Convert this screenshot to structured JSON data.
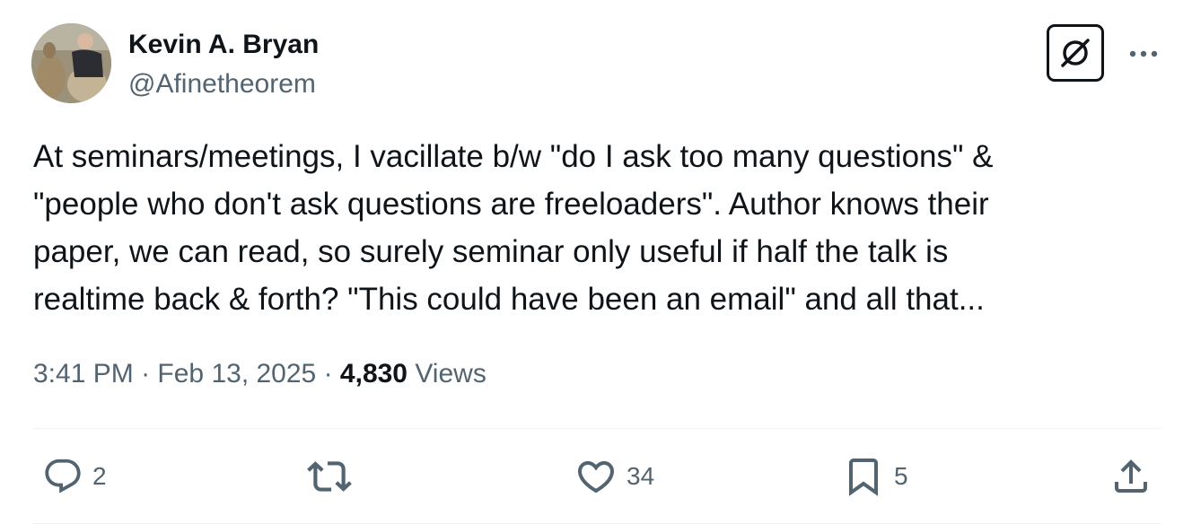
{
  "author": {
    "name": "Kevin A. Bryan",
    "handle": "@Afinetheorem"
  },
  "tweet": {
    "lines": [
      "At seminars/meetings, I vacillate b/w \"do I ask too many questions\" &",
      "\"people who don't ask questions are freeloaders\". Author knows their",
      "paper, we can read, so surely seminar only useful if half the talk is",
      "realtime back & forth? \"This could have been an email\" and all that..."
    ]
  },
  "meta": {
    "time": "3:41 PM",
    "separator": "·",
    "date": "Feb 13, 2025",
    "views_count": "4,830",
    "views_label": "Views"
  },
  "actions": {
    "replies": "2",
    "retweets": "",
    "likes": "34",
    "bookmarks": "5"
  },
  "icons": {
    "grok": "grok-icon",
    "more": "more-icon",
    "reply": "reply-icon",
    "retweet": "retweet-icon",
    "like": "heart-icon",
    "bookmark": "bookmark-icon",
    "share": "share-icon"
  },
  "colors": {
    "text": "#0f1419",
    "secondary": "#536471",
    "divider": "#eff3f4"
  }
}
